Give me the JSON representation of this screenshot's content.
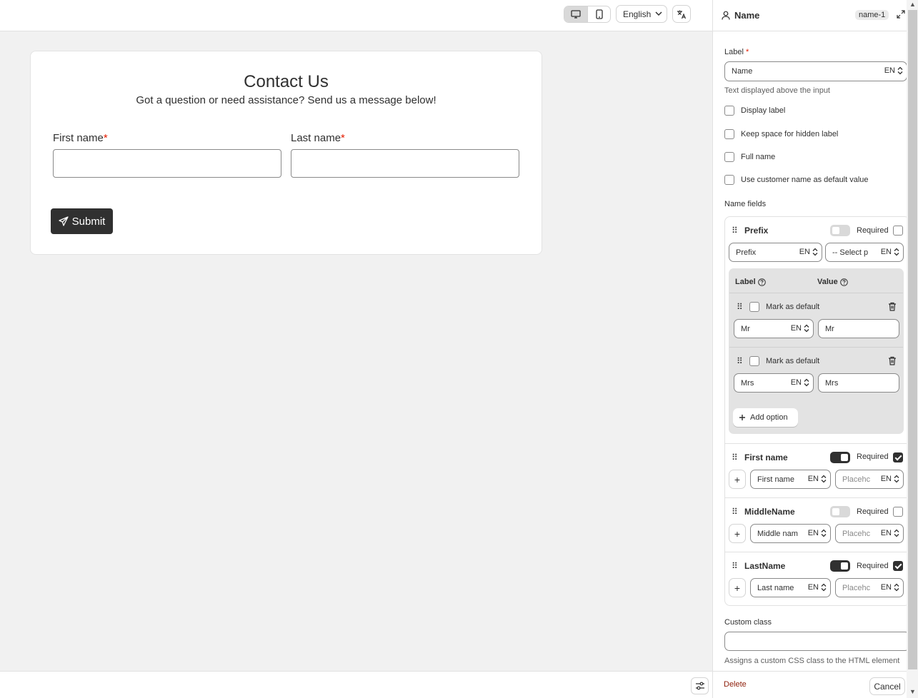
{
  "toolbar": {
    "language": "English",
    "icons": [
      "desktop-icon",
      "mobile-icon",
      "chevron-down-icon",
      "translate-icon"
    ]
  },
  "form": {
    "title": "Contact Us",
    "subtitle": "Got a question or need assistance? Send us a message below!",
    "first_name_label": "First name",
    "last_name_label": "Last name",
    "required_mark": "*",
    "submit_label": "Submit"
  },
  "panel": {
    "title": "Name",
    "badge": "name-1",
    "label_title": "Label",
    "required_mark": "*",
    "label_value": "Name",
    "lang": "EN",
    "label_help": "Text displayed above the input",
    "checkboxes": [
      {
        "label": "Display label",
        "checked": false
      },
      {
        "label": "Keep space for hidden label",
        "checked": false
      },
      {
        "label": "Full name",
        "checked": false
      },
      {
        "label": "Use customer name as default value",
        "checked": false
      }
    ],
    "name_fields_title": "Name fields",
    "required_text": "Required",
    "prefix": {
      "title": "Prefix",
      "label_value": "Prefix",
      "select_value": "-- Select p",
      "col_label": "Label",
      "col_value": "Value",
      "mark_default": "Mark as default",
      "options": [
        {
          "label": "Mr",
          "value": "Mr"
        },
        {
          "label": "Mrs",
          "value": "Mrs"
        }
      ],
      "add_option": "Add option"
    },
    "fields": [
      {
        "title": "First name",
        "label_value": "First name",
        "placeholder": "Placehc",
        "enabled": true,
        "required": true
      },
      {
        "title": "MiddleName",
        "label_value": "Middle nam",
        "placeholder": "Placehc",
        "enabled": false,
        "required": false
      },
      {
        "title": "LastName",
        "label_value": "Last name",
        "placeholder": "Placehc",
        "enabled": true,
        "required": true
      }
    ],
    "custom_class_title": "Custom class",
    "custom_class_help": "Assigns a custom CSS class to the HTML element",
    "delete_label": "Delete",
    "cancel_label": "Cancel"
  }
}
